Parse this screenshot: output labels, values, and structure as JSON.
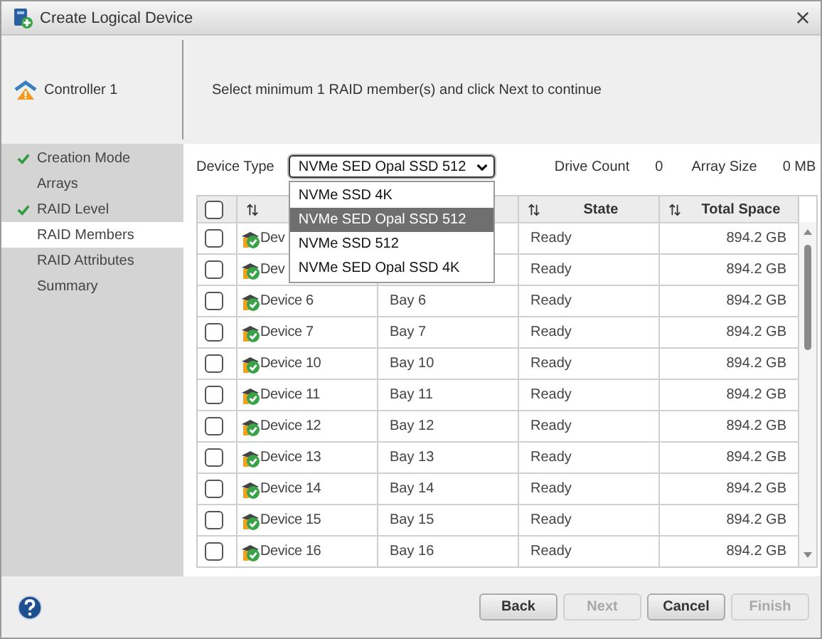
{
  "window": {
    "title": "Create Logical Device"
  },
  "header": {
    "controller": "Controller 1",
    "instruction": "Select minimum 1 RAID member(s) and click Next to continue"
  },
  "steps": [
    {
      "label": "Creation Mode",
      "completed": true,
      "selected": false
    },
    {
      "label": "Arrays",
      "completed": false,
      "selected": false
    },
    {
      "label": "RAID Level",
      "completed": true,
      "selected": false
    },
    {
      "label": "RAID Members",
      "completed": false,
      "selected": true
    },
    {
      "label": "RAID Attributes",
      "completed": false,
      "selected": false
    },
    {
      "label": "Summary",
      "completed": false,
      "selected": false
    }
  ],
  "device_type": {
    "label": "Device Type",
    "value": "NVMe SED Opal SSD 512",
    "expanded": true,
    "options": [
      {
        "label": "NVMe SSD 4K",
        "selected": false
      },
      {
        "label": "NVMe SED Opal SSD 512",
        "selected": true
      },
      {
        "label": "NVMe SSD 512",
        "selected": false
      },
      {
        "label": "NVMe SED Opal SSD 4K",
        "selected": false
      }
    ]
  },
  "drive_count": {
    "label": "Drive Count",
    "value": "0"
  },
  "array_size": {
    "label": "Array Size",
    "value": "0 MB"
  },
  "table": {
    "columns": [
      {
        "kind": "checkbox",
        "checked": false
      },
      {
        "kind": "sort"
      },
      {
        "kind": "covered"
      },
      {
        "kind": "sort",
        "label": "State"
      },
      {
        "kind": "sort",
        "label": "Total Space"
      }
    ],
    "rows": [
      {
        "checked": false,
        "device": "Dev",
        "state": "Ready",
        "total_space": "894.2 GB"
      },
      {
        "checked": false,
        "device": "Dev",
        "state": "Ready",
        "total_space": "894.2 GB"
      },
      {
        "checked": false,
        "device": "Device 6",
        "bay": "Bay 6",
        "state": "Ready",
        "total_space": "894.2 GB"
      },
      {
        "checked": false,
        "device": "Device 7",
        "bay": "Bay 7",
        "state": "Ready",
        "total_space": "894.2 GB"
      },
      {
        "checked": false,
        "device": "Device 10",
        "bay": "Bay 10",
        "state": "Ready",
        "total_space": "894.2 GB"
      },
      {
        "checked": false,
        "device": "Device 11",
        "bay": "Bay 11",
        "state": "Ready",
        "total_space": "894.2 GB"
      },
      {
        "checked": false,
        "device": "Device 12",
        "bay": "Bay 12",
        "state": "Ready",
        "total_space": "894.2 GB"
      },
      {
        "checked": false,
        "device": "Device 13",
        "bay": "Bay 13",
        "state": "Ready",
        "total_space": "894.2 GB"
      },
      {
        "checked": false,
        "device": "Device 14",
        "bay": "Bay 14",
        "state": "Ready",
        "total_space": "894.2 GB"
      },
      {
        "checked": false,
        "device": "Device 15",
        "bay": "Bay 15",
        "state": "Ready",
        "total_space": "894.2 GB"
      },
      {
        "checked": false,
        "device": "Device 16",
        "bay": "Bay 16",
        "state": "Ready",
        "total_space": "894.2 GB"
      }
    ]
  },
  "buttons": [
    {
      "label": "Back",
      "disabled": false
    },
    {
      "label": "Next",
      "disabled": true
    },
    {
      "label": "Cancel",
      "disabled": false
    },
    {
      "label": "Finish",
      "disabled": true
    }
  ]
}
